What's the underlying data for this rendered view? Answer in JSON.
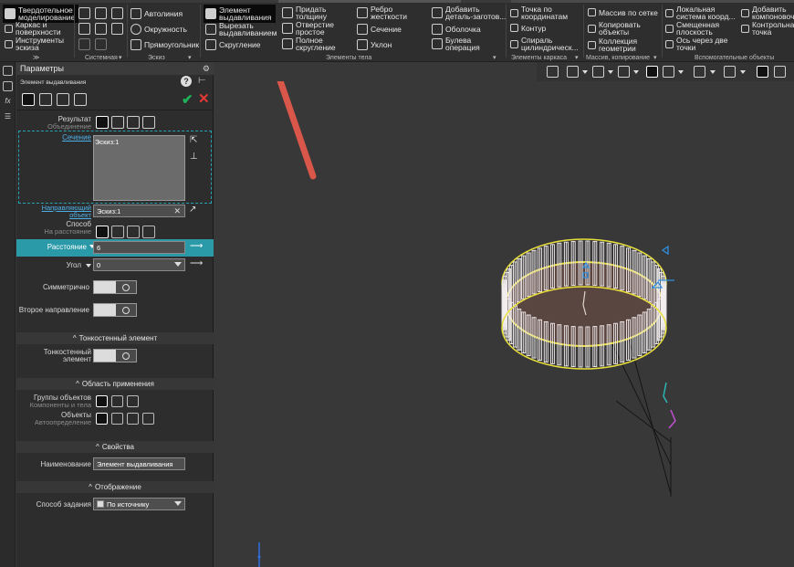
{
  "ribbon": {
    "mode_1": "Твердотельное",
    "mode_2": "моделирование",
    "frames_1": "Каркас и",
    "frames_2": "поверхности",
    "sketch_tools_1": "Инструменты",
    "sketch_tools_2": "эскиза",
    "autoline": "Автолиния",
    "circle": "Окружность",
    "rectangle": "Прямоугольник",
    "extrude_1": "Элемент",
    "extrude_2": "выдавливания",
    "cut_extrude_1": "Вырезать",
    "cut_extrude_2": "выдавливанием",
    "fillet": "Скругление",
    "thicken_1": "Придать",
    "thicken_2": "толщину",
    "simple_hole_1": "Отверстие",
    "simple_hole_2": "простое",
    "full_round_1": "Полное",
    "full_round_2": "скругление",
    "rib_1": "Ребро",
    "rib_2": "жесткости",
    "section": "Сечение",
    "draft": "Уклон",
    "add_part_1": "Добавить",
    "add_part_2": "деталь-заготов...",
    "shell": "Оболочка",
    "boolean_1": "Булева",
    "boolean_2": "операция",
    "point_coords_1": "Точка по",
    "point_coords_2": "координатам",
    "contour": "Контур",
    "spiral_1": "Спираль",
    "spiral_2": "цилиндрическ...",
    "grid_array": "Массив по сетке",
    "copy_objects_1": "Копировать",
    "copy_objects_2": "объекты",
    "geometry_collection_1": "Коллекция",
    "geometry_collection_2": "геометрии",
    "local_cs_1": "Локальная",
    "local_cs_2": "система коорд...",
    "offset_plane_1": "Смещенная",
    "offset_plane_2": "плоскость",
    "axis_two_points_1": "Ось через две",
    "axis_two_points_2": "точки",
    "add_layout_1": "Добавить",
    "add_layout_2": "компоновоч...",
    "control_point_1": "Контрольная",
    "control_point_2": "точка",
    "groups": {
      "system": "Системная",
      "sketch": "Эскиз",
      "body_elements": "Элементы тела",
      "frame_elements": "Элементы каркаса",
      "array_copy": "Массив, копирование",
      "aux_objects": "Вспомогательные объекты"
    }
  },
  "panel": {
    "title": "Параметры",
    "operation": "Элемент выдавливания",
    "result_label": "Результат",
    "result_sub": "Объединение",
    "section_link": "Сечение",
    "sketch_item": "Эскиз:1",
    "direction_link_1": "Направляющий",
    "direction_link_2": "объект",
    "direction_value": "Эскиз:1",
    "method_label": "Способ",
    "method_sub": "На расстояние",
    "distance_label": "Расстояние",
    "distance_value": "6",
    "angle_label": "Угол",
    "angle_value": "0",
    "symmetric_label": "Симметрично",
    "second_dir_label": "Второе направление",
    "thin_wall_section": "Тонкостенный элемент",
    "thin_wall_label_1": "Тонкостенный",
    "thin_wall_label_2": "элемент",
    "scope_section": "Область применения",
    "object_groups_label": "Группы объектов",
    "object_groups_sub": "Компоненты и тела",
    "objects_label": "Объекты",
    "objects_sub": "Автоопределение",
    "properties_section": "Свойства",
    "name_label": "Наименование",
    "name_value": "Элемент выдавливания",
    "display_section": "Отображение",
    "spec_method_label": "Способ задания",
    "spec_method_value": "По источнику"
  },
  "colors": {
    "accent_teal": "#2a99a8",
    "ok_green": "#1fb25a",
    "cancel_red": "#e53935",
    "arrow_red": "#d9574a",
    "model_yellow": "#e8e03a"
  }
}
